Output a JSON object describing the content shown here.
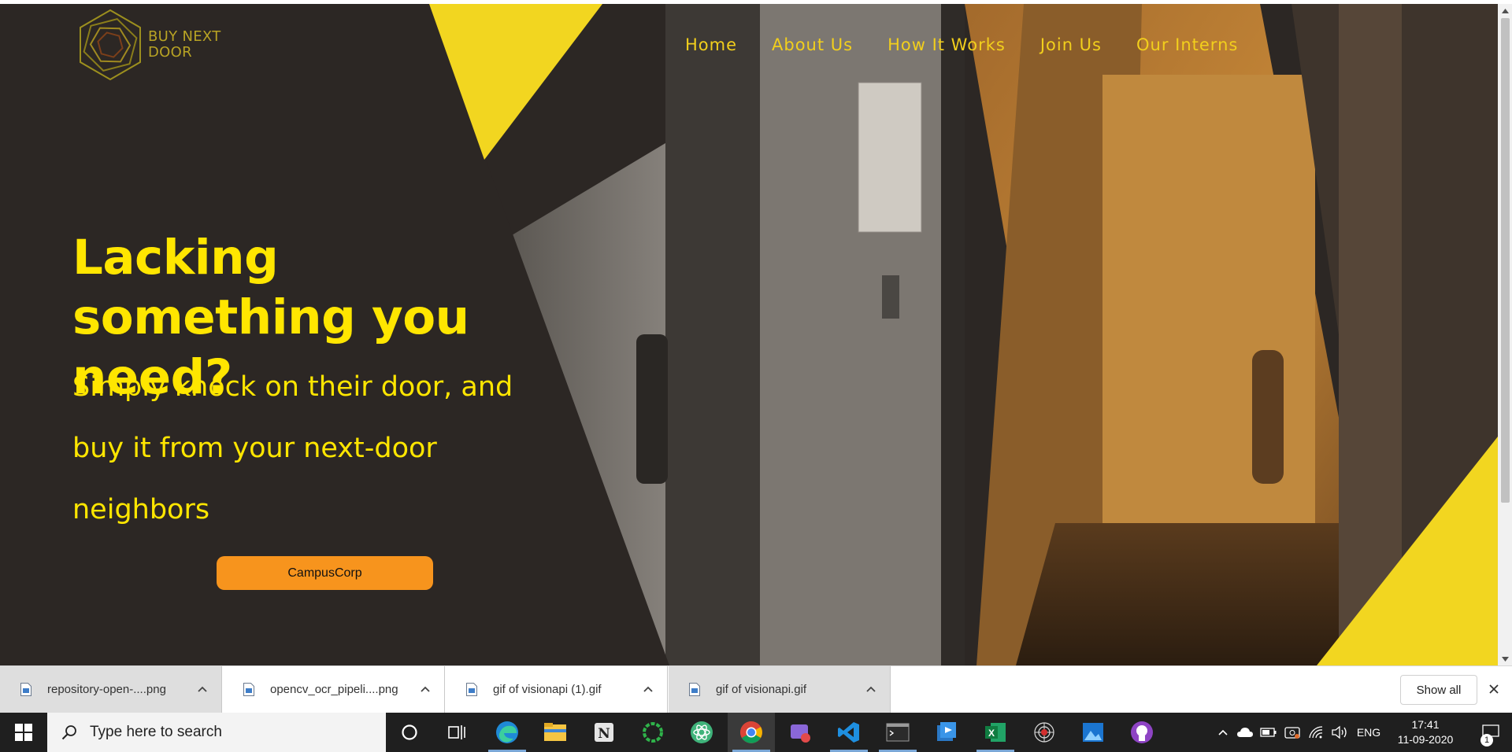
{
  "site": {
    "logo_text": "BUY NEXT\nDOOR",
    "nav": [
      {
        "label": "Home"
      },
      {
        "label": "About Us"
      },
      {
        "label": "How It Works"
      },
      {
        "label": "Join Us"
      },
      {
        "label": "Our Interns"
      }
    ],
    "headline": "Lacking something you need?",
    "subline": "Simply knock on their door, and buy it from your next-door neighbors",
    "cta_label": "CampusCorp"
  },
  "colors": {
    "hero_background": "#2c2724",
    "accent_yellow": "#f2d620",
    "cta_orange": "#f7941d",
    "nav_text": "#f2cf1c"
  },
  "download_shelf": {
    "items": [
      {
        "name": "repository-open-....png",
        "icon": "image-file-icon"
      },
      {
        "name": "opencv_ocr_pipeli....png",
        "icon": "image-file-icon"
      },
      {
        "name": "gif of visionapi (1).gif",
        "icon": "image-file-icon"
      },
      {
        "name": "gif of visionapi.gif",
        "icon": "image-file-icon"
      }
    ],
    "show_all_label": "Show all"
  },
  "taskbar": {
    "search_placeholder": "Type here to search",
    "apps": [
      "cortana-icon",
      "task-view-icon",
      "edge-icon",
      "file-explorer-icon",
      "notion-icon",
      "app-ring-icon",
      "atom-icon",
      "chrome-icon",
      "snipping-icon",
      "vscode-icon",
      "terminal-icon",
      "powerbi-icon",
      "excel-icon",
      "spider-icon",
      "photos-icon",
      "github-desktop-icon"
    ],
    "tray": {
      "language": "ENG",
      "time": "17:41",
      "date": "11-09-2020",
      "notification_count": "1"
    }
  }
}
